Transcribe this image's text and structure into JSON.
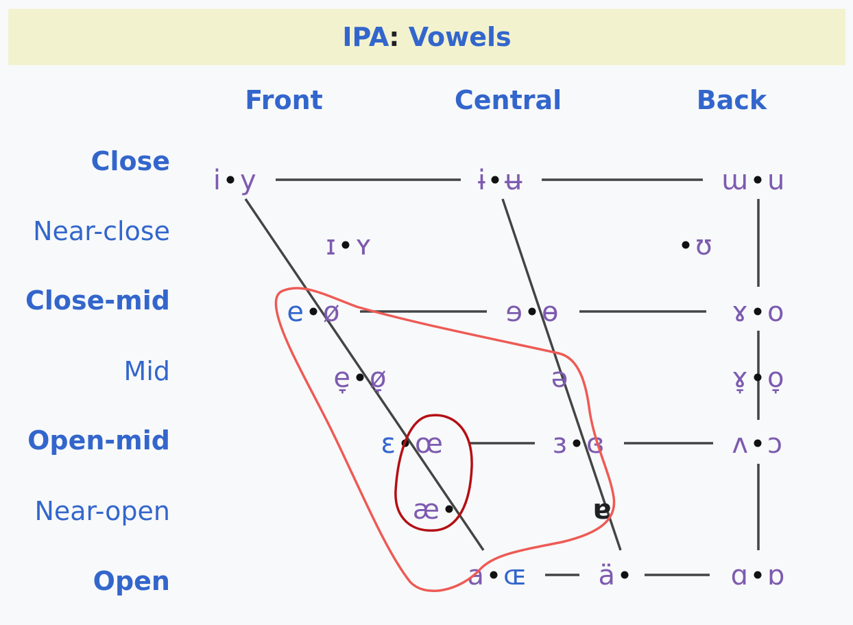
{
  "title": {
    "prefix": "IPA",
    "colon": ":",
    "suffix": "Vowels"
  },
  "columns": [
    "Front",
    "Central",
    "Back"
  ],
  "rows": [
    {
      "label": "Close",
      "bold": true
    },
    {
      "label": "Near-close",
      "bold": false
    },
    {
      "label": "Close-mid",
      "bold": true
    },
    {
      "label": "Mid",
      "bold": false
    },
    {
      "label": "Open-mid",
      "bold": true
    },
    {
      "label": "Near-open",
      "bold": false
    },
    {
      "label": "Open",
      "bold": true
    }
  ],
  "vowels": [
    {
      "name": "close-front-unrounded",
      "symbol": "i",
      "color": "purple"
    },
    {
      "name": "close-front-rounded",
      "symbol": "y",
      "color": "purple"
    },
    {
      "name": "close-central-unrounded",
      "symbol": "ɨ",
      "color": "purple"
    },
    {
      "name": "close-central-rounded",
      "symbol": "ʉ",
      "color": "purple"
    },
    {
      "name": "close-back-unrounded",
      "symbol": "ɯ",
      "color": "purple"
    },
    {
      "name": "close-back-rounded",
      "symbol": "u",
      "color": "purple"
    },
    {
      "name": "near-close-front-unrounded",
      "symbol": "ɪ",
      "color": "purple"
    },
    {
      "name": "near-close-front-rounded",
      "symbol": "ʏ",
      "color": "purple"
    },
    {
      "name": "near-close-back-rounded",
      "symbol": "ʊ",
      "color": "purple"
    },
    {
      "name": "close-mid-front-unrounded",
      "symbol": "e",
      "color": "blue"
    },
    {
      "name": "close-mid-front-rounded",
      "symbol": "ø",
      "color": "purple"
    },
    {
      "name": "close-mid-central-unrounded",
      "symbol": "ɘ",
      "color": "purple"
    },
    {
      "name": "close-mid-central-rounded",
      "symbol": "ɵ",
      "color": "purple"
    },
    {
      "name": "close-mid-back-unrounded",
      "symbol": "ɤ",
      "color": "purple"
    },
    {
      "name": "close-mid-back-rounded",
      "symbol": "o",
      "color": "purple"
    },
    {
      "name": "mid-front-unrounded",
      "symbol": "e̞",
      "color": "purple"
    },
    {
      "name": "mid-front-rounded",
      "symbol": "ø̞",
      "color": "purple"
    },
    {
      "name": "mid-central",
      "symbol": "ə",
      "color": "purple"
    },
    {
      "name": "mid-back-unrounded",
      "symbol": "ɤ̞",
      "color": "purple"
    },
    {
      "name": "mid-back-rounded",
      "symbol": "o̞",
      "color": "purple"
    },
    {
      "name": "open-mid-front-unrounded",
      "symbol": "ɛ",
      "color": "blue"
    },
    {
      "name": "open-mid-front-rounded",
      "symbol": "œ",
      "color": "purple"
    },
    {
      "name": "open-mid-central-unrounded",
      "symbol": "ɜ",
      "color": "purple"
    },
    {
      "name": "open-mid-central-rounded",
      "symbol": "ɞ",
      "color": "purple"
    },
    {
      "name": "open-mid-back-unrounded",
      "symbol": "ʌ",
      "color": "purple"
    },
    {
      "name": "open-mid-back-rounded",
      "symbol": "ɔ",
      "color": "purple"
    },
    {
      "name": "near-open-front-unrounded",
      "symbol": "æ",
      "color": "purple"
    },
    {
      "name": "near-open-central",
      "symbol": "ɐ",
      "color": "black"
    },
    {
      "name": "open-front-unrounded",
      "symbol": "a",
      "color": "purple"
    },
    {
      "name": "open-front-rounded",
      "symbol": "ɶ",
      "color": "blue"
    },
    {
      "name": "open-central-unrounded",
      "symbol": "ä",
      "color": "purple"
    },
    {
      "name": "open-back-unrounded",
      "symbol": "ɑ",
      "color": "purple"
    },
    {
      "name": "open-back-rounded",
      "symbol": "ɒ",
      "color": "purple"
    }
  ],
  "colors": {
    "header_bg": "#f2f2cf",
    "link_blue": "#3366cc",
    "symbol_purple": "#7d5bb0",
    "line_gray": "#444444",
    "annotation_red_light": "#ee5a55",
    "annotation_red_dark": "#b40f14",
    "page_bg": "#f8f9fa"
  },
  "annotations": [
    {
      "name": "large-freehand-circle",
      "color": "annotation_red_light",
      "encloses": [
        "e",
        "ø",
        "e̞",
        "ø̞",
        "ɛ",
        "œ",
        "æ",
        "a",
        "ɶ",
        "ə",
        "ɞ",
        "ɐ"
      ]
    },
    {
      "name": "small-freehand-circle",
      "color": "annotation_red_dark",
      "encloses": [
        "œ",
        "æ"
      ]
    }
  ]
}
